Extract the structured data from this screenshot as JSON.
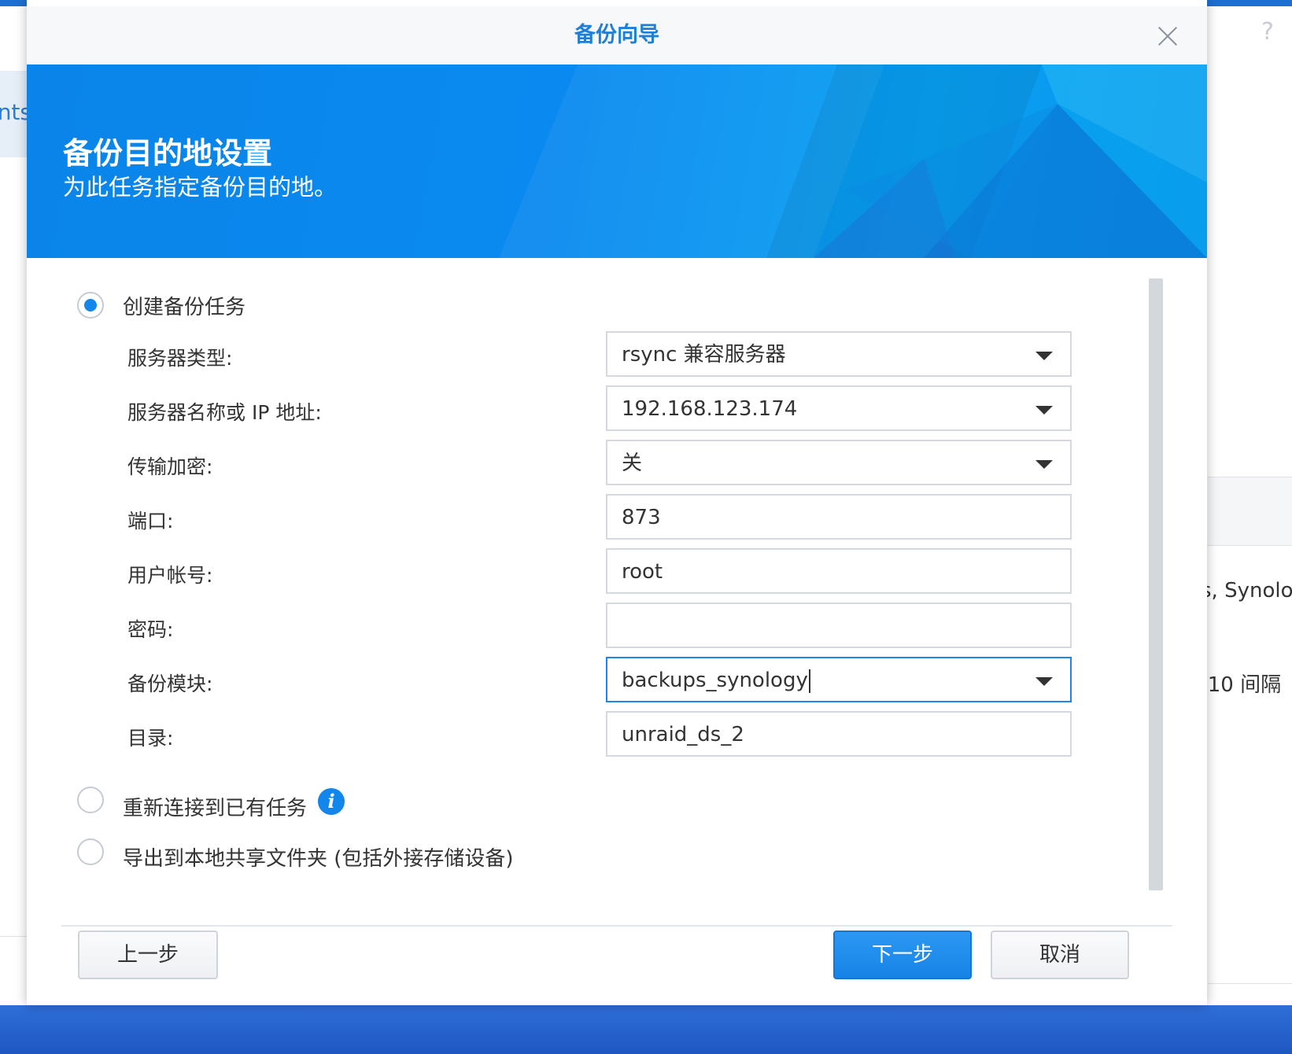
{
  "background": {
    "left_tab_text": "nts",
    "right_text_1": "s, Synolo",
    "right_text_2": ":10 间隔"
  },
  "dialog": {
    "title": "备份向导",
    "banner": {
      "title": "备份目的地设置",
      "subtitle": "为此任务指定备份目的地。"
    },
    "options": {
      "create_task": "创建备份任务",
      "reconnect_task": "重新连接到已有任务",
      "export_local": "导出到本地共享文件夹 (包括外接存储设备)"
    },
    "selected_option": "create_task",
    "fields": {
      "server_type": {
        "label": "服务器类型:",
        "value": "rsync 兼容服务器"
      },
      "server_name": {
        "label": "服务器名称或 IP 地址:",
        "value": "192.168.123.174"
      },
      "encryption": {
        "label": "传输加密:",
        "value": "关"
      },
      "port": {
        "label": "端口:",
        "value": "873"
      },
      "username": {
        "label": "用户帐号:",
        "value": "root"
      },
      "password": {
        "label": "密码:",
        "value": ""
      },
      "backup_module": {
        "label": "备份模块:",
        "value": "backups_synology"
      },
      "directory": {
        "label": "目录:",
        "value": "unraid_ds_2"
      }
    },
    "buttons": {
      "back": "上一步",
      "next": "下一步",
      "cancel": "取消"
    },
    "colors": {
      "accent": "#1386ec",
      "title": "#1f7fd6",
      "banner": "#0a8af0"
    }
  }
}
